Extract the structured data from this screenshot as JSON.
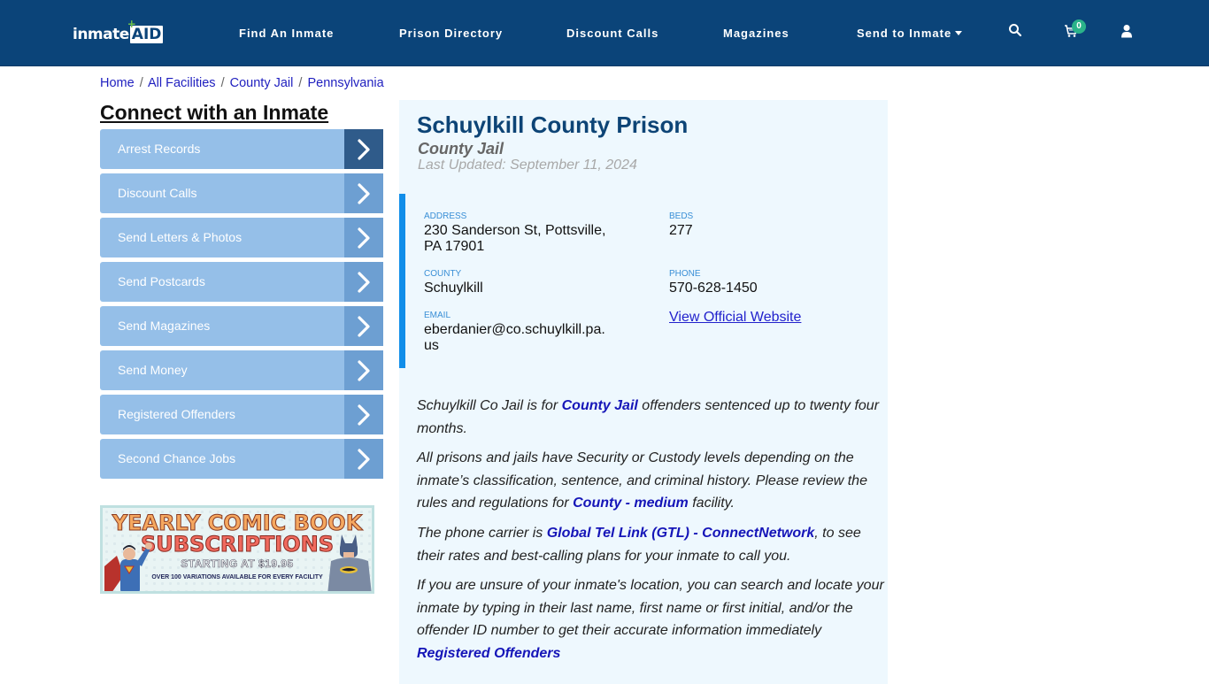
{
  "header": {
    "logo": {
      "main": "inmate",
      "accent": "AID",
      "plus": "+"
    },
    "nav": [
      {
        "label": "Find An Inmate"
      },
      {
        "label": "Prison Directory"
      },
      {
        "label": "Discount Calls"
      },
      {
        "label": "Magazines"
      },
      {
        "label": "Send to Inmate",
        "has_dropdown": true
      }
    ],
    "icons": [
      "search-icon",
      "cart-icon",
      "user-icon"
    ],
    "cart_count": "0"
  },
  "breadcrumb": [
    {
      "label": "Home"
    },
    {
      "label": "All Facilities"
    },
    {
      "label": "County Jail"
    },
    {
      "label": "Pennsylvania"
    }
  ],
  "breadcrumb_sep": "/",
  "sidebar": {
    "title": "Connect with an Inmate",
    "items": [
      {
        "label": "Arrest Records"
      },
      {
        "label": "Discount Calls"
      },
      {
        "label": "Send Letters & Photos"
      },
      {
        "label": "Send Postcards"
      },
      {
        "label": "Send Magazines"
      },
      {
        "label": "Send Money"
      },
      {
        "label": "Registered Offenders"
      },
      {
        "label": "Second Chance Jobs"
      }
    ],
    "ad": {
      "line1": "YEARLY COMIC BOOK",
      "line2": "SUBSCRIPTIONS",
      "line3": "STARTING AT $19.95",
      "line4": "OVER 100 VARIATIONS AVAILABLE FOR EVERY FACILITY"
    }
  },
  "facility": {
    "name": "Schuylkill County Prison",
    "type": "County Jail",
    "last_updated": "Last Updated: September 11, 2024",
    "fields": {
      "address_label": "ADDRESS",
      "address_line1": "230 Sanderson St, Pottsville,",
      "address_line2": "PA 17901",
      "beds_label": "BEDS",
      "beds": "277",
      "county_label": "COUNTY",
      "county": "Schuylkill",
      "phone_label": "PHONE",
      "phone": "570-628-1450",
      "email_label": "EMAIL",
      "email_line1": "eberdanier@co.schuylkill.pa.",
      "email_line2": "us",
      "website_link": "View Official Website"
    },
    "paragraphs": {
      "p1_a": "Schuylkill Co Jail is for ",
      "p1_link": "County Jail",
      "p1_b": " offenders sentenced up to twenty four months.",
      "p2_a": "All prisons and jails have Security or Custody levels depending on the inmate’s classification, sentence, and criminal history. Please review the rules and regulations for ",
      "p2_link": "County - medium",
      "p2_b": " facility.",
      "p3_a": "The phone carrier is ",
      "p3_link": "Global Tel Link (GTL) - ConnectNetwork",
      "p3_b": ", to see their rates and best-calling plans for your inmate to call you.",
      "p4_a": "If you are unsure of your inmate's location, you can search and locate your inmate by typing in their last name, first name or first initial, and/or the offender ID number to get their accurate information immediately",
      "p4_link": "Registered Offenders"
    }
  },
  "colors": {
    "header_bg": "#0b4479",
    "sidebar_item_bg": "#95bfe8",
    "sidebar_chevron_bg": "#6d9fd2",
    "sidebar_chevron_active_bg": "#2f5b8a",
    "panel_bg": "#eef8fe",
    "accent_border": "#118ee9",
    "link": "#1515b8",
    "cart_badge": "#2bb38a"
  }
}
